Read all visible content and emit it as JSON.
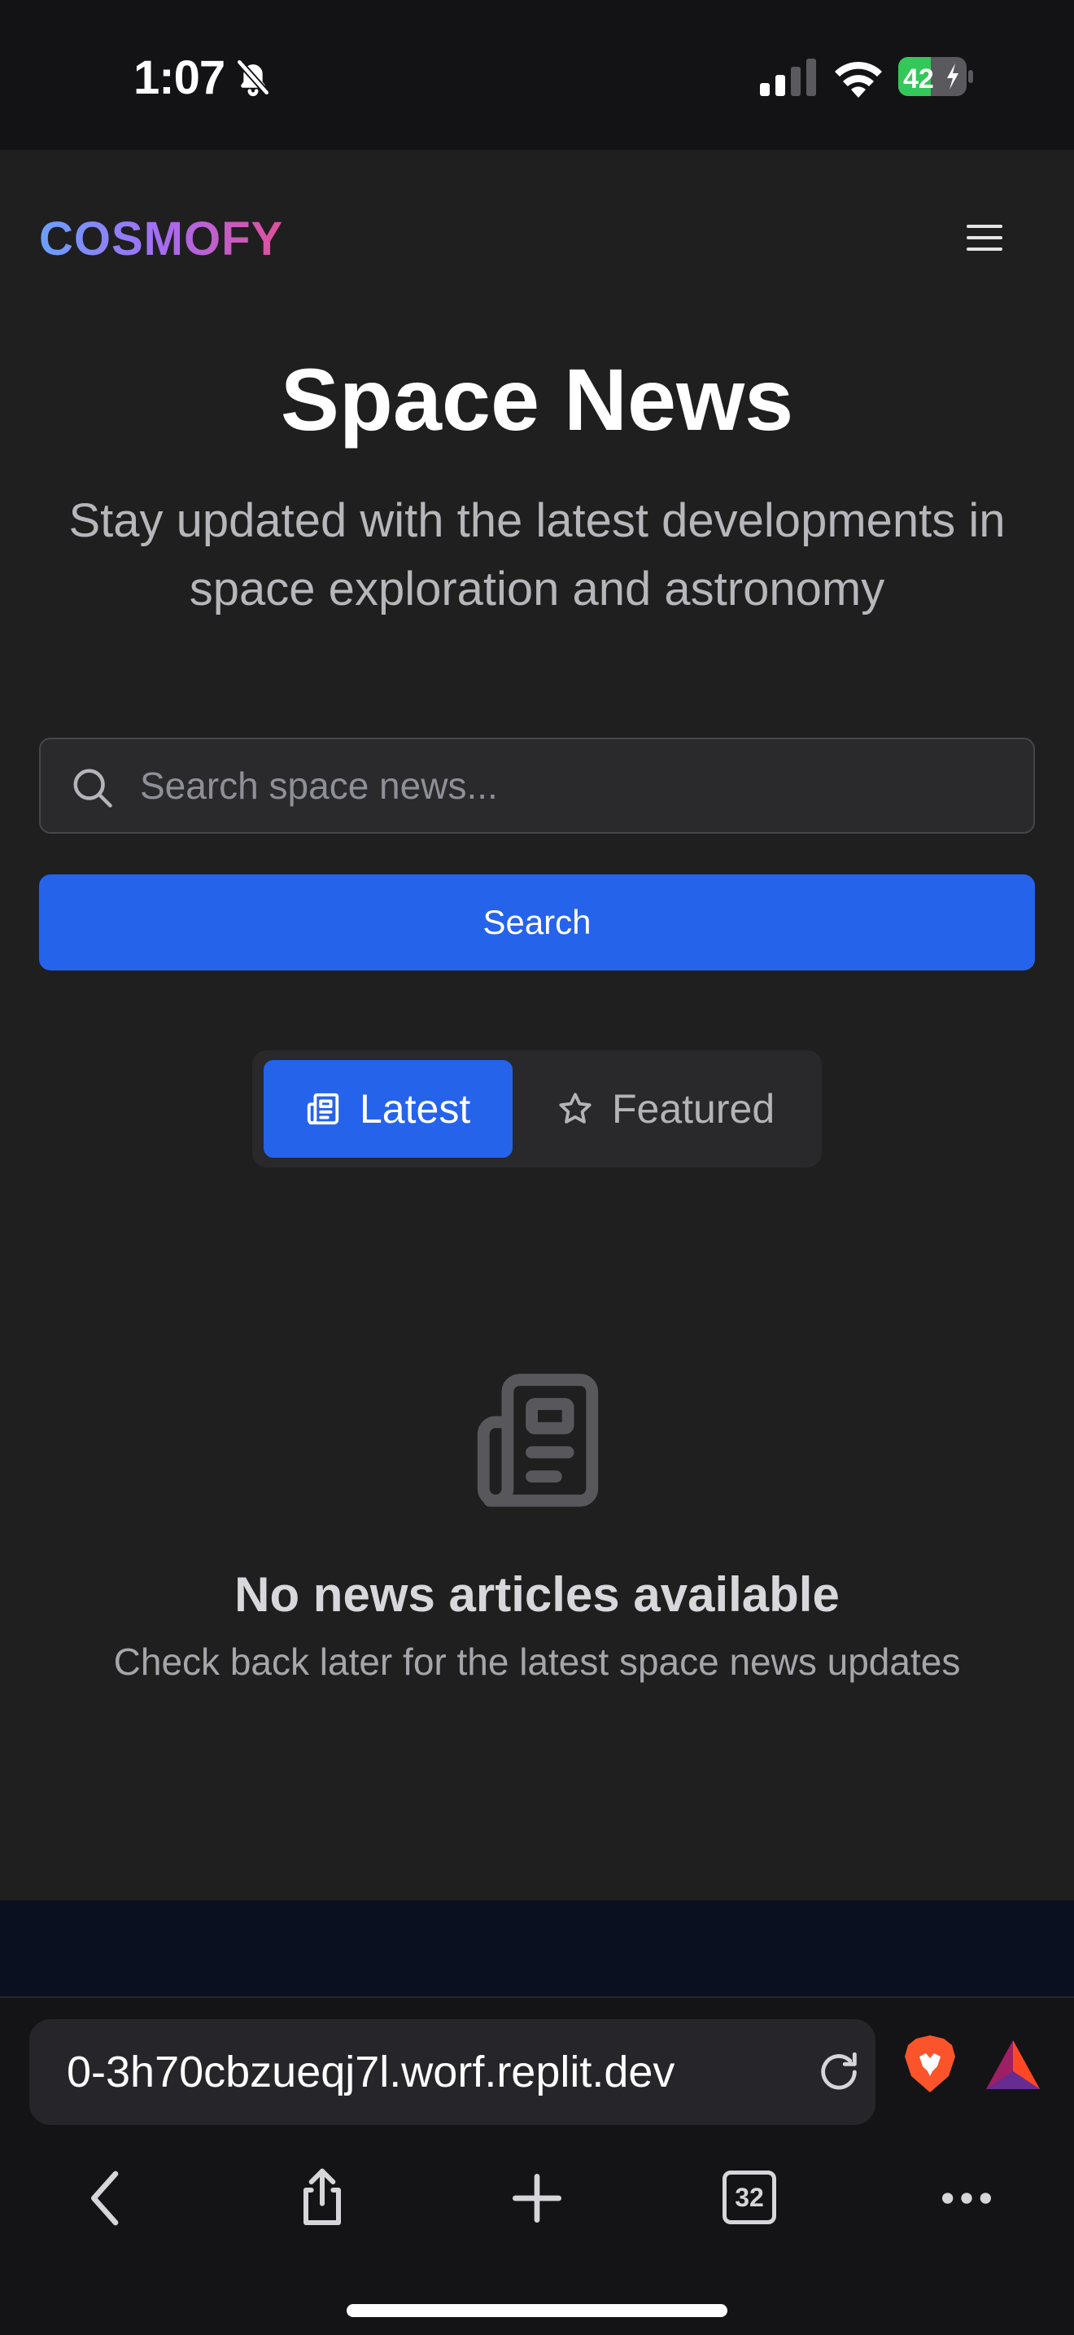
{
  "status_bar": {
    "time": "1:07",
    "battery": "42"
  },
  "header": {
    "brand": "COSMOFY"
  },
  "hero": {
    "title": "Space News",
    "subtitle": "Stay updated with the latest developments in space exploration and astronomy"
  },
  "search": {
    "placeholder": "Search space news...",
    "value": "",
    "button_label": "Search"
  },
  "tabs": [
    {
      "label": "Latest",
      "icon": "newspaper-icon",
      "active": true
    },
    {
      "label": "Featured",
      "icon": "star-icon",
      "active": false
    }
  ],
  "empty_state": {
    "icon": "newspaper-icon",
    "title": "No news articles available",
    "subtitle": "Check back later for the latest space news updates"
  },
  "browser": {
    "url": "0-3h70cbzueqj7l.worf.replit.dev",
    "tab_count": "32"
  },
  "colors": {
    "accent": "#2563eb",
    "page_bg": "#1f1f20",
    "brand_gradient": [
      "#6aa0ff",
      "#a56cf3",
      "#e24f9a"
    ]
  }
}
